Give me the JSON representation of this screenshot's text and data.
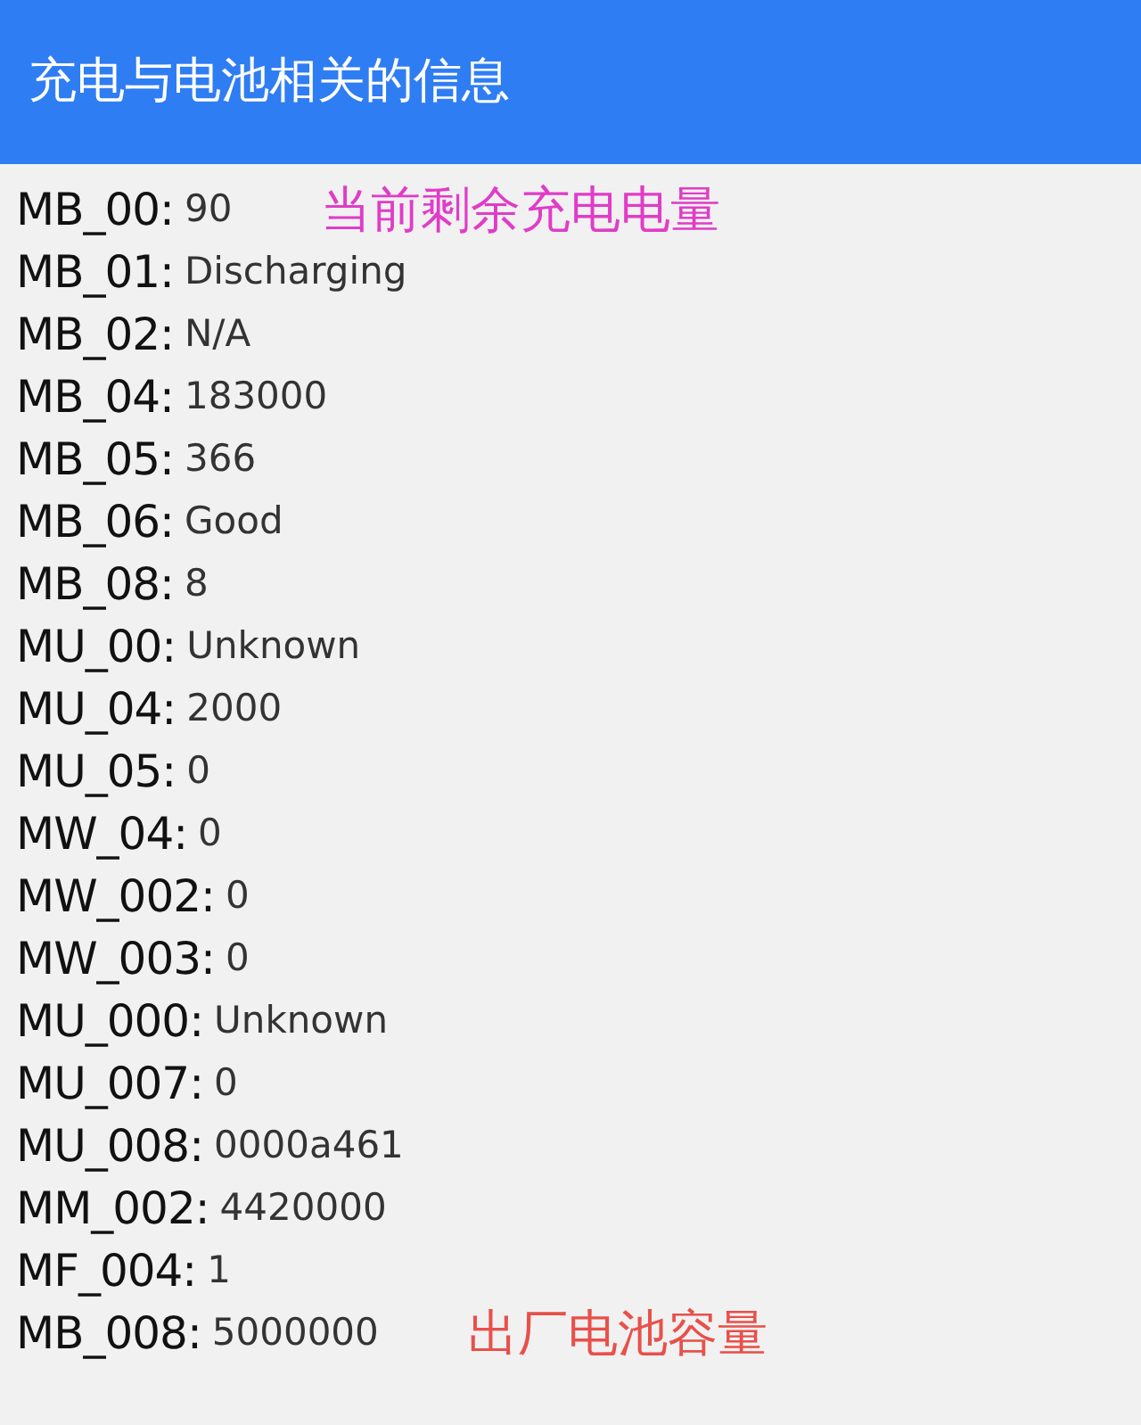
{
  "app_bar": {
    "title": "充电与电池相关的信息"
  },
  "rows": [
    {
      "key": "MB_00:",
      "value": "90",
      "note": {
        "text": "当前剩余充电电量",
        "color": "#e03cc8"
      }
    },
    {
      "key": "MB_01:",
      "value": "Discharging"
    },
    {
      "key": "MB_02:",
      "value": "N/A"
    },
    {
      "key": "MB_04:",
      "value": "183000"
    },
    {
      "key": "MB_05:",
      "value": "366"
    },
    {
      "key": "MB_06:",
      "value": "Good"
    },
    {
      "key": "MB_08:",
      "value": "8"
    },
    {
      "key": "MU_00:",
      "value": "Unknown"
    },
    {
      "key": "MU_04:",
      "value": "2000"
    },
    {
      "key": "MU_05:",
      "value": "0"
    },
    {
      "key": "MW_04:",
      "value": "0"
    },
    {
      "key": "MW_002:",
      "value": "0"
    },
    {
      "key": "MW_003:",
      "value": "0"
    },
    {
      "key": "MU_000:",
      "value": "Unknown"
    },
    {
      "key": "MU_007:",
      "value": "0"
    },
    {
      "key": "MU_008:",
      "value": "0000a461"
    },
    {
      "key": "MM_002:",
      "value": "4420000"
    },
    {
      "key": "MF_004:",
      "value": "1"
    },
    {
      "key": "MB_008:",
      "value": "5000000",
      "note": {
        "text": "出厂电池容量",
        "color": "#e8504a"
      }
    }
  ]
}
